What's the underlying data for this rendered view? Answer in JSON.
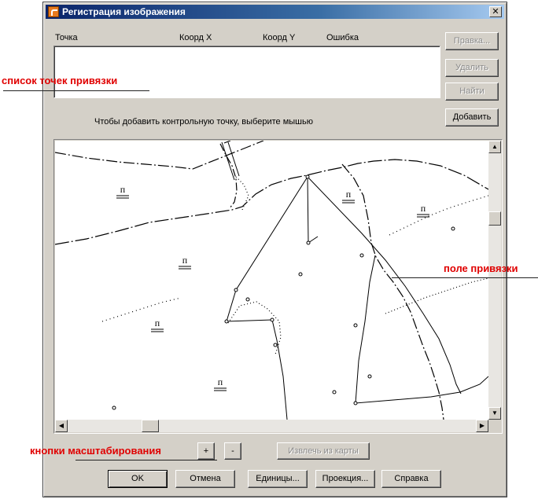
{
  "window": {
    "title": "Регистрация изображения",
    "close_glyph": "✕"
  },
  "table": {
    "columns": [
      "Точка",
      "Коорд X",
      "Коорд Y",
      "Ошибка"
    ],
    "rows": []
  },
  "buttons": {
    "edit": "Правка...",
    "delete": "Удалить",
    "find": "Найти",
    "add": "Добавить",
    "zoom_in": "+",
    "zoom_out": "-",
    "extract": "Извлечь из карты",
    "ok": "OK",
    "cancel": "Отмена",
    "units": "Единицы...",
    "projection": "Проекция...",
    "help": "Справка"
  },
  "hint": "Чтобы добавить контрольную точку, выберите мышью",
  "map": {
    "labels": [
      "п",
      "п",
      "п",
      "п",
      "п",
      "п"
    ]
  },
  "annotations": {
    "points_list": "список точек привязки",
    "binding_field": "поле привязки",
    "zoom_buttons": "кнопки масштабирования"
  },
  "colors": {
    "title_start": "#0a246a",
    "title_end": "#a6caf0",
    "annotation": "#e00000",
    "dialog_bg": "#d4d0c8"
  },
  "icons": {
    "app": "registration-app-icon",
    "close": "close-icon"
  }
}
